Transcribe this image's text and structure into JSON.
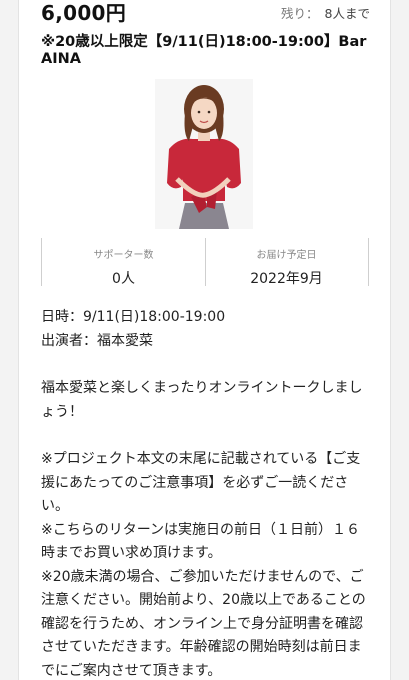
{
  "reward": {
    "price": "6,000円",
    "remaining_label": "残り：",
    "remaining_value": "8人まで",
    "title": "※20歳以上限定【9/11(日)18:00-19:00】Bar AINA"
  },
  "stats": {
    "supporters_label": "サポーター数",
    "supporters_value": "0人",
    "delivery_label": "お届け予定日",
    "delivery_value": "2022年9月"
  },
  "details": {
    "datetime": "日時：9/11(日)18:00-19:00",
    "performer": "出演者：福本愛菜",
    "intro": "福本愛菜と楽しくまったりオンライントークしましょう！",
    "note1": "※プロジェクト本文の末尾に記載されている【ご支援にあたってのご注意事項】を必ずご一読ください。",
    "note2": "※こちらのリターンは実施日の前日（１日前）１６時までお買い求め頂けます。",
    "note3": "※20歳未満の場合、ご参加いただけませんので、ご注意ください。開始前より、20歳以上であることの確認を行うため、オンライン上で身分証明書を確認させていただきます。年齢確認の開始時刻は前日までにご案内させて頂きます。"
  },
  "colors": {
    "accent_dress": "#c8283a",
    "text": "#222222",
    "muted": "#888888"
  }
}
